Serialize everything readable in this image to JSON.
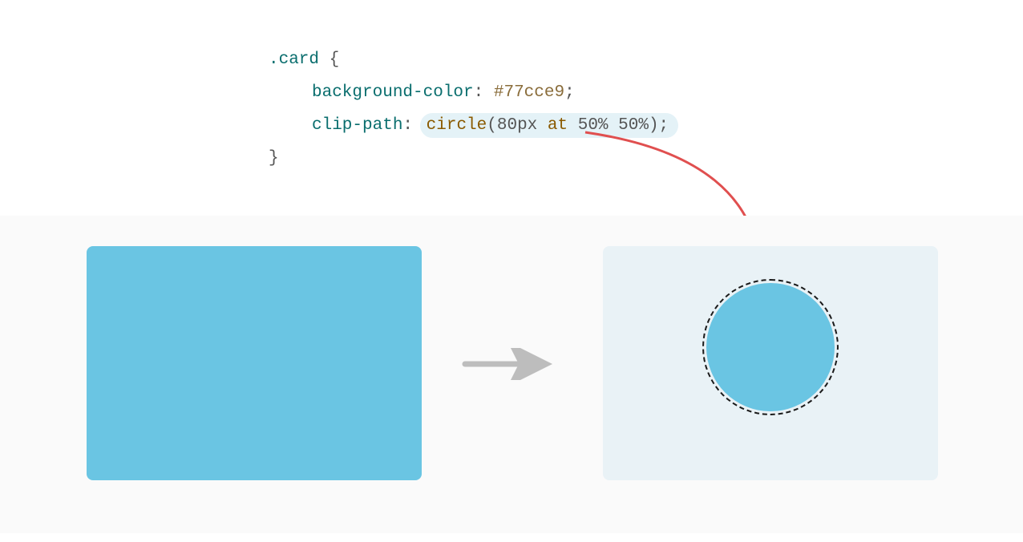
{
  "code": {
    "selector": ".card",
    "brace_open": "{",
    "brace_close": "}",
    "prop1_name": "background-color",
    "prop1_value": "#77cce9",
    "prop2_name": "clip-path",
    "prop2_func": "circle",
    "prop2_args_pre": "80px ",
    "prop2_args_at": "at",
    "prop2_args_post": " 50% 50%",
    "colon": ":",
    "semicolon": ";",
    "paren_open": "(",
    "paren_close": ")"
  },
  "colors": {
    "card_bg": "#6ac5e3",
    "card_ghost": "#e9f2f6",
    "arrow_red": "#e04f4f",
    "arrow_gray": "#bdbdbd"
  }
}
